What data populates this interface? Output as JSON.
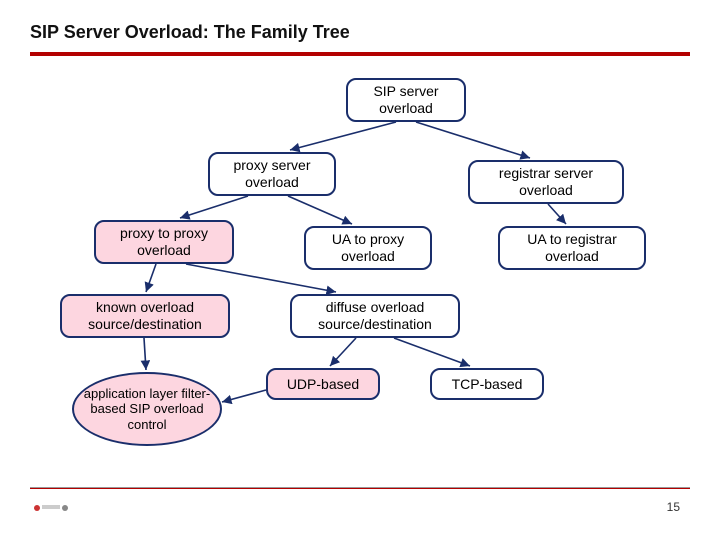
{
  "slide": {
    "title": "SIP Server Overload: The Family Tree",
    "page_number": "15"
  },
  "nodes": {
    "root": "SIP server overload",
    "proxy_server": "proxy server overload",
    "registrar_server": "registrar server overload",
    "proxy_to_proxy": "proxy to proxy overload",
    "ua_to_proxy": "UA to proxy overload",
    "ua_to_registrar": "UA to registrar overload",
    "known_src": "known overload source/destination",
    "diffuse_src": "diffuse overload source/destination",
    "udp_based": "UDP-based",
    "tcp_based": "TCP-based",
    "app_layer": "application layer filter-based SIP overload control"
  },
  "colors": {
    "accent": "#b30000",
    "node_border": "#1a2e6b",
    "highlight_fill": "#fdd6e0"
  },
  "edges": [
    [
      "root",
      "proxy_server"
    ],
    [
      "root",
      "registrar_server"
    ],
    [
      "proxy_server",
      "proxy_to_proxy"
    ],
    [
      "proxy_server",
      "ua_to_proxy"
    ],
    [
      "registrar_server",
      "ua_to_registrar"
    ],
    [
      "proxy_to_proxy",
      "known_src"
    ],
    [
      "proxy_to_proxy",
      "diffuse_src"
    ],
    [
      "diffuse_src",
      "udp_based"
    ],
    [
      "diffuse_src",
      "tcp_based"
    ],
    [
      "known_src",
      "app_layer"
    ],
    [
      "udp_based",
      "app_layer"
    ]
  ]
}
